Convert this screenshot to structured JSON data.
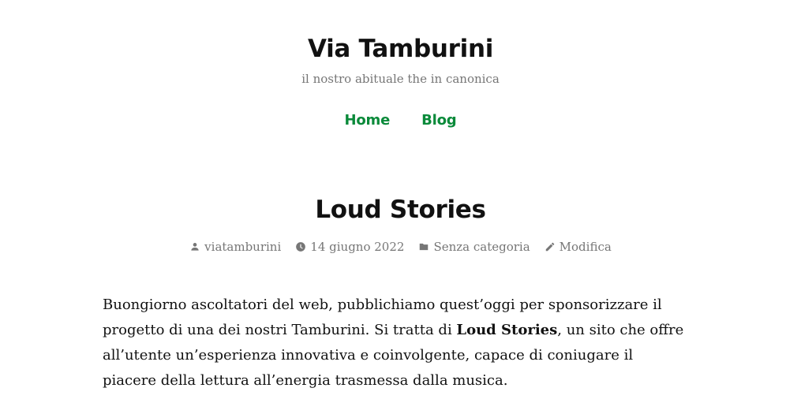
{
  "site": {
    "title": "Via Tamburini",
    "description": "il nostro abituale the in canonica"
  },
  "nav": {
    "items": [
      {
        "label": "Home"
      },
      {
        "label": "Blog"
      }
    ],
    "link_color": "#0a8a3a"
  },
  "post": {
    "title": "Loud Stories",
    "meta": {
      "author": "viatamburini",
      "date": "14 giugno 2022",
      "category": "Senza categoria",
      "edit": "Modifica"
    },
    "content": {
      "before_bold": "Buongiorno ascoltatori del web, pubblichiamo quest’oggi per sponsorizzare il progetto di una dei nostri Tamburini. Si tratta di ",
      "bold": "Loud Stories",
      "after_bold": ", un sito che offre all’utente un’esperienza innovativa e coinvolgente, capace di coniugare il piacere della lettura all’energia trasmessa dalla musica."
    }
  },
  "icons": {
    "author": "person-icon",
    "date": "clock-icon",
    "category": "folder-icon",
    "edit": "pencil-icon"
  }
}
